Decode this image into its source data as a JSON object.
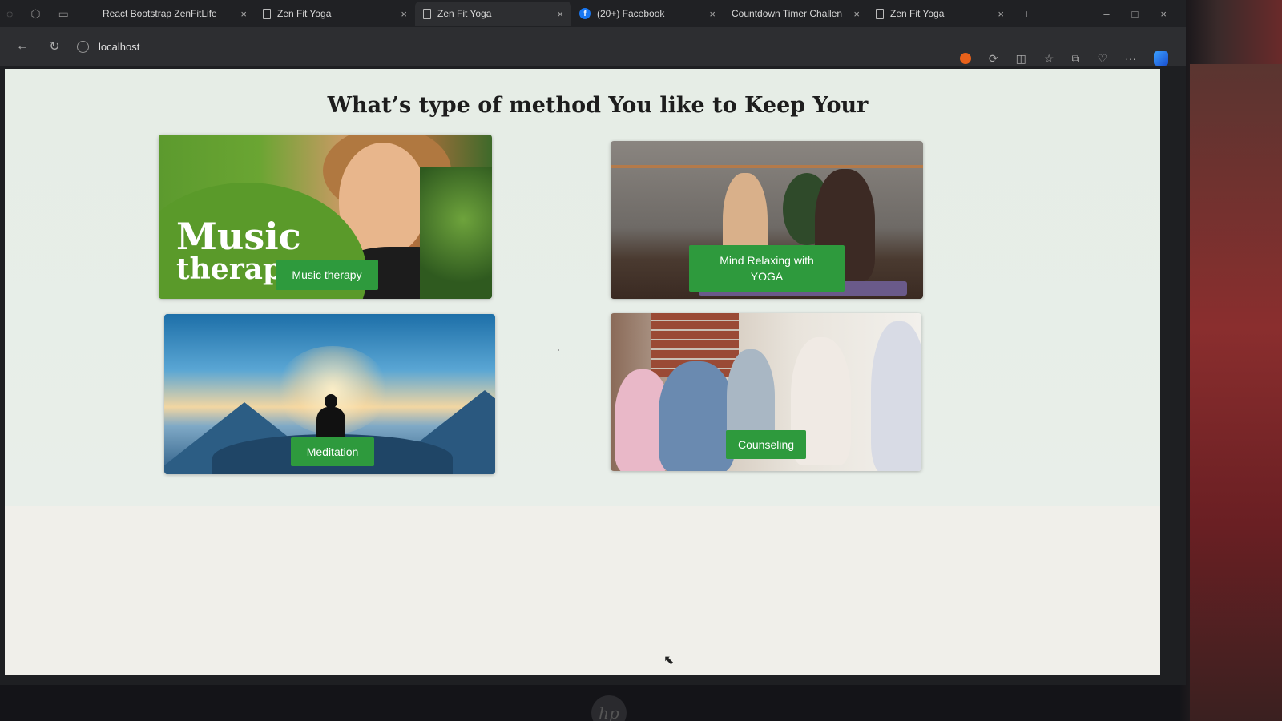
{
  "browser": {
    "tabs": [
      {
        "title": "React Bootstrap ZenFitLife",
        "icon": "page-icon",
        "active": false
      },
      {
        "title": "Zen Fit Yoga",
        "icon": "page-icon",
        "active": false
      },
      {
        "title": "Zen Fit Yoga",
        "icon": "page-icon",
        "active": true
      },
      {
        "title": "(20+) Facebook",
        "icon": "facebook-icon",
        "active": false
      },
      {
        "title": "Countdown Timer Challen",
        "icon": "page-icon",
        "active": false
      },
      {
        "title": "Zen Fit Yoga",
        "icon": "page-icon",
        "active": false
      }
    ],
    "tab_close": "×",
    "new_tab": "+",
    "address": "localhost",
    "info_glyph": "i",
    "back_glyph": "←",
    "reload_glyph": "↻",
    "minimize_glyph": "–",
    "maximize_glyph": "□",
    "close_glyph": "×",
    "more_glyph": "···"
  },
  "page": {
    "title": "What’s type of method You like to Keep Your",
    "cards": [
      {
        "id": "music",
        "image_text_line1": "Music",
        "image_text_line2": "therapy",
        "label": "Music therapy"
      },
      {
        "id": "yoga",
        "label": "Mind Relaxing with YOGA"
      },
      {
        "id": "meditation",
        "label": "Meditation"
      },
      {
        "id": "counseling",
        "label": "Counseling"
      }
    ]
  },
  "colors": {
    "label_green": "#2e9a3d",
    "page_bg": "#e4ebe5"
  }
}
